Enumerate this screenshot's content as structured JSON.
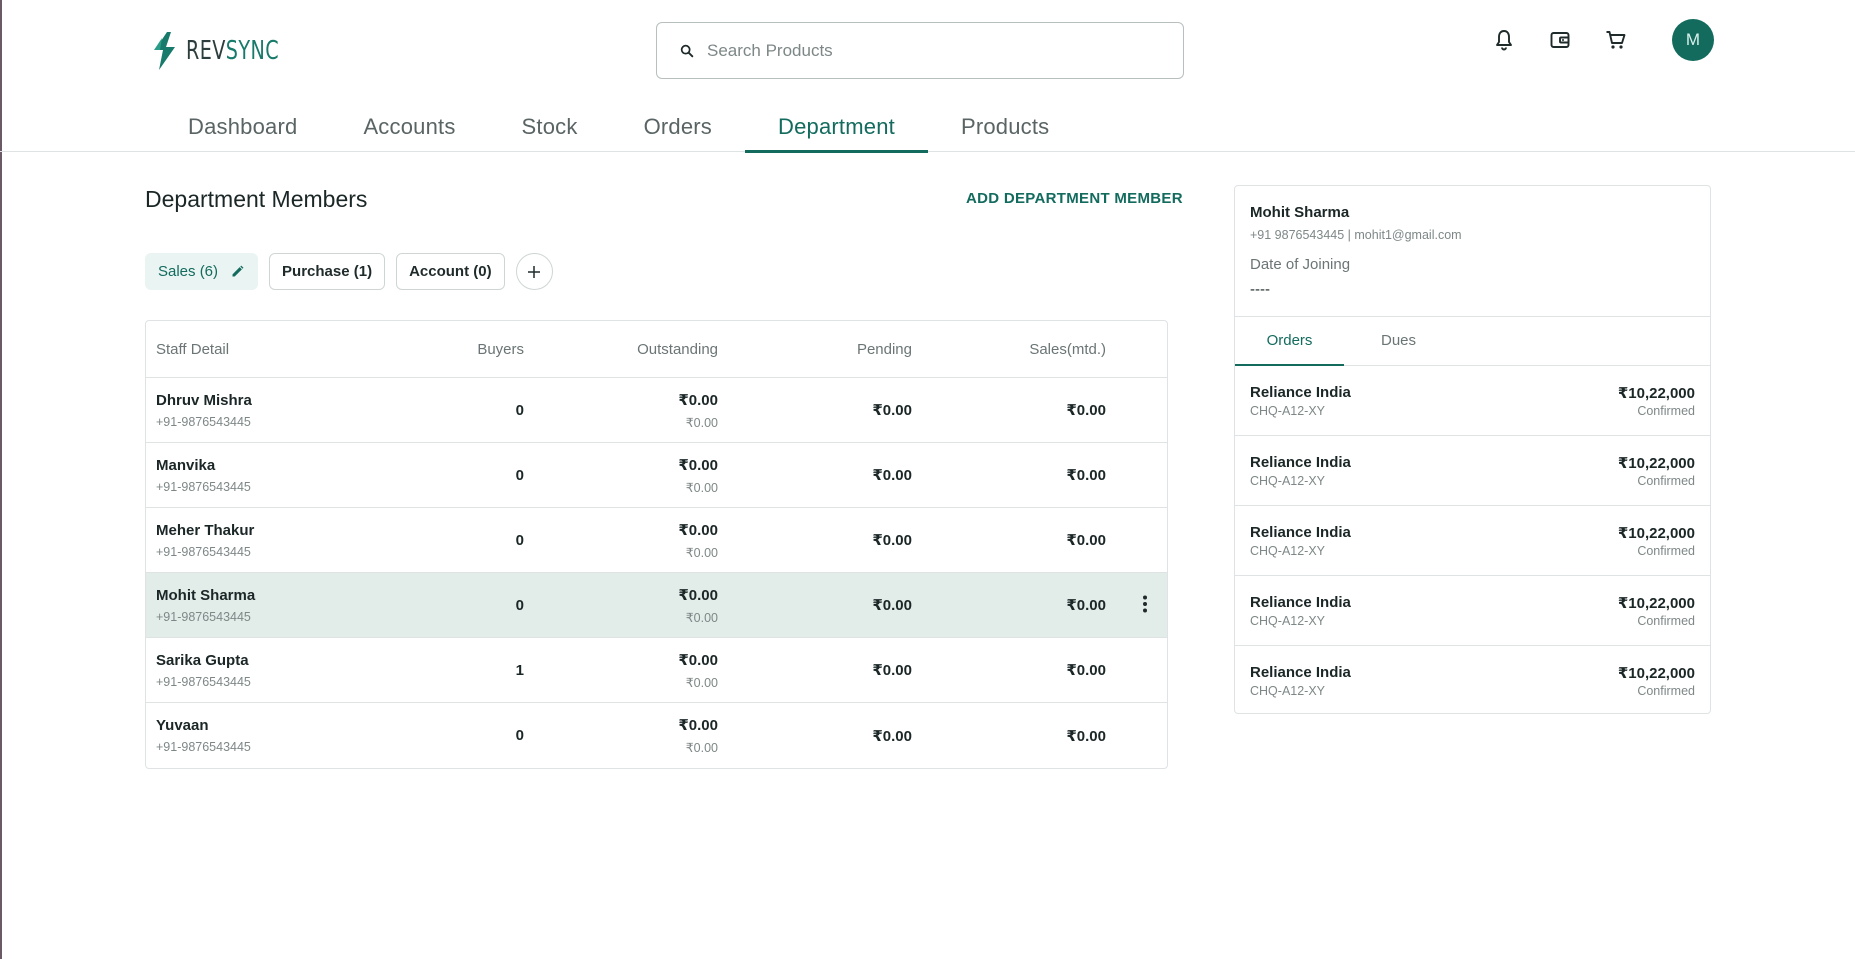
{
  "brand": {
    "name_part1": "REV",
    "name_part2": "SYNC"
  },
  "search": {
    "placeholder": "Search Products",
    "value": ""
  },
  "header": {
    "icons": [
      "bell-icon",
      "wallet-icon",
      "cart-icon"
    ],
    "avatar_initial": "M",
    "accent": "#136b5e"
  },
  "nav": {
    "items": [
      {
        "label": "Dashboard",
        "active": false
      },
      {
        "label": "Accounts",
        "active": false
      },
      {
        "label": "Stock",
        "active": false
      },
      {
        "label": "Orders",
        "active": false
      },
      {
        "label": "Department",
        "active": true
      },
      {
        "label": "Products",
        "active": false
      }
    ]
  },
  "main": {
    "title": "Department Members",
    "add_button": "ADD DEPARTMENT MEMBER",
    "chips": [
      {
        "label": "Sales (6)",
        "active": true
      },
      {
        "label": "Purchase (1)",
        "active": false
      },
      {
        "label": "Account (0)",
        "active": false
      }
    ],
    "table": {
      "headers": [
        "Staff Detail",
        "Buyers",
        "Outstanding",
        "Pending",
        "Sales(mtd.)"
      ],
      "rows": [
        {
          "name": "Dhruv Mishra",
          "phone": "+91-9876543445",
          "buyers": "0",
          "outstanding": "₹0.00",
          "outstanding_sub": "₹0.00",
          "pending": "₹0.00",
          "sales": "₹0.00",
          "selected": false
        },
        {
          "name": "Manvika",
          "phone": "+91-9876543445",
          "buyers": "0",
          "outstanding": "₹0.00",
          "outstanding_sub": "₹0.00",
          "pending": "₹0.00",
          "sales": "₹0.00",
          "selected": false
        },
        {
          "name": "Meher Thakur",
          "phone": "+91-9876543445",
          "buyers": "0",
          "outstanding": "₹0.00",
          "outstanding_sub": "₹0.00",
          "pending": "₹0.00",
          "sales": "₹0.00",
          "selected": false
        },
        {
          "name": "Mohit Sharma",
          "phone": "+91-9876543445",
          "buyers": "0",
          "outstanding": "₹0.00",
          "outstanding_sub": "₹0.00",
          "pending": "₹0.00",
          "sales": "₹0.00",
          "selected": true
        },
        {
          "name": "Sarika Gupta",
          "phone": "+91-9876543445",
          "buyers": "1",
          "outstanding": "₹0.00",
          "outstanding_sub": "₹0.00",
          "pending": "₹0.00",
          "sales": "₹0.00",
          "selected": false
        },
        {
          "name": "Yuvaan",
          "phone": "+91-9876543445",
          "buyers": "0",
          "outstanding": "₹0.00",
          "outstanding_sub": "₹0.00",
          "pending": "₹0.00",
          "sales": "₹0.00",
          "selected": false
        }
      ]
    }
  },
  "panel": {
    "name": "Mohit Sharma",
    "contact": "+91 9876543445 | mohit1@gmail.com",
    "doj_label": "Date of Joining",
    "doj_value": "----",
    "tabs": [
      {
        "label": "Orders",
        "active": true
      },
      {
        "label": "Dues",
        "active": false
      }
    ],
    "orders": [
      {
        "party": "Reliance India",
        "ref": "CHQ-A12-XY",
        "amount": "₹10,22,000",
        "status": "Confirmed"
      },
      {
        "party": "Reliance India",
        "ref": "CHQ-A12-XY",
        "amount": "₹10,22,000",
        "status": "Confirmed"
      },
      {
        "party": "Reliance India",
        "ref": "CHQ-A12-XY",
        "amount": "₹10,22,000",
        "status": "Confirmed"
      },
      {
        "party": "Reliance India",
        "ref": "CHQ-A12-XY",
        "amount": "₹10,22,000",
        "status": "Confirmed"
      },
      {
        "party": "Reliance India",
        "ref": "CHQ-A12-XY",
        "amount": "₹10,22,000",
        "status": "Confirmed"
      }
    ]
  }
}
